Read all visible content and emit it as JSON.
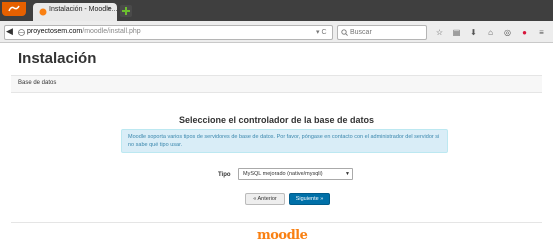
{
  "browser": {
    "tab_title": "Instalación - Moodle...",
    "tab_close": "×",
    "url_host": "proyectosem.com",
    "url_path": "/moodle/install.php",
    "reload_glyph": "▾ C",
    "search_placeholder": "Buscar",
    "nav_icons": [
      "star-icon",
      "bookmarks-icon",
      "download-icon",
      "home-icon",
      "sync-icon",
      "pocket-icon",
      "menu-icon"
    ]
  },
  "page": {
    "title": "Instalación",
    "breadcrumb": "Base de datos",
    "section_title": "Seleccione el controlador de la base de datos",
    "info": "Moodle soporta varios tipos de servidores de base de datos. Por favor, póngase en contacto con el administrador del servidor si no sabe qué tipo usar.",
    "tipo_label": "Tipo",
    "tipo_value": "MySQL mejorado (native/mysqli)",
    "prev_button": "« Anterior",
    "next_button": "Siguiente »",
    "logo_text": "moodle"
  },
  "colors": {
    "accent": "#0070a8",
    "info_bg": "#d9edf7",
    "info_text": "#3a87ad",
    "logo": "#f98012",
    "firefox": "#e66000"
  }
}
